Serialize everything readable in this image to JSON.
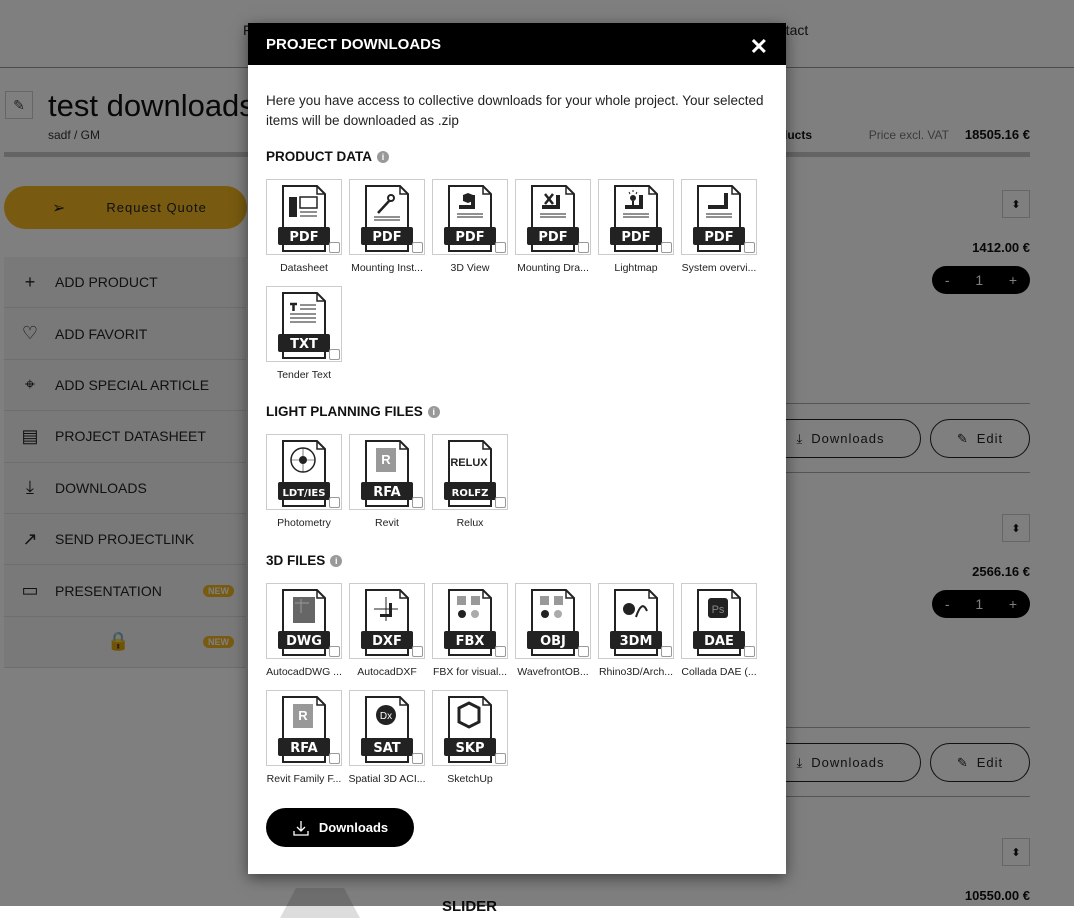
{
  "page": {
    "nav_left": "F",
    "nav_contact": "Contact",
    "title": "test downloads",
    "subtitle": "sadf / GM",
    "request_quote": "Request Quote",
    "sidebar": [
      {
        "icon": "plus-icon",
        "glyph": "+",
        "label": "ADD PRODUCT"
      },
      {
        "icon": "heart-plus-icon",
        "glyph": "♡",
        "label": "ADD FAVORIT"
      },
      {
        "icon": "tag-icon",
        "glyph": "⌖",
        "label": "ADD SPECIAL ARTICLE"
      },
      {
        "icon": "document-icon",
        "glyph": "▤",
        "label": "PROJECT DATASHEET"
      },
      {
        "icon": "download-icon",
        "glyph": "⤓",
        "label": "DOWNLOADS"
      },
      {
        "icon": "external-link-icon",
        "glyph": "↗",
        "label": "SEND PROJECTLINK"
      },
      {
        "icon": "presentation-icon",
        "glyph": "▭",
        "label": "PRESENTATION",
        "badge": "NEW"
      },
      {
        "icon": "lock-icon",
        "glyph": "🔒",
        "label": "",
        "badge": "NEW"
      }
    ],
    "products_label": "Products",
    "price_label": "Price excl. VAT",
    "total": "18505.16 €",
    "items": [
      {
        "price": "1412.00 €",
        "qty": "1"
      },
      {
        "price": "2566.16 €",
        "qty": "1"
      },
      {
        "price": "10550.00 €",
        "name": "SLIDER"
      }
    ],
    "downloads_btn": "Downloads",
    "edit_btn": "Edit",
    "minus": "-",
    "plus": "+"
  },
  "modal": {
    "title": "PROJECT DOWNLOADS",
    "close": "✕",
    "intro": "Here you have access to collective downloads for your whole project. Your selected items will be downloaded as .zip",
    "download_button": "Downloads",
    "sections": [
      {
        "title": "PRODUCT DATA",
        "items": [
          {
            "label": "Datasheet",
            "type": "PDF",
            "glyph": "datasheet"
          },
          {
            "label": "Mounting Inst...",
            "type": "PDF",
            "glyph": "wrench"
          },
          {
            "label": "3D View",
            "type": "PDF",
            "glyph": "cube"
          },
          {
            "label": "Mounting Dra...",
            "type": "PDF",
            "glyph": "tools"
          },
          {
            "label": "Lightmap",
            "type": "PDF",
            "glyph": "bulb"
          },
          {
            "label": "System overvi...",
            "type": "PDF",
            "glyph": "corner"
          },
          {
            "label": "Tender Text",
            "type": "TXT",
            "glyph": "text"
          }
        ]
      },
      {
        "title": "LIGHT PLANNING FILES",
        "items": [
          {
            "label": "Photometry",
            "type": "LDT/IES",
            "glyph": "photometry"
          },
          {
            "label": "Revit",
            "type": "RFA",
            "glyph": "revit"
          },
          {
            "label": "Relux",
            "type": "ROLFZ",
            "glyph": "relux"
          }
        ]
      },
      {
        "title": "3D FILES",
        "items": [
          {
            "label": "AutocadDWG ...",
            "type": "DWG",
            "glyph": "dwg"
          },
          {
            "label": "AutocadDXF",
            "type": "DXF",
            "glyph": "crosshair"
          },
          {
            "label": "FBX for visual...",
            "type": "FBX",
            "glyph": "apps"
          },
          {
            "label": "WavefrontOB...",
            "type": "OBJ",
            "glyph": "apps"
          },
          {
            "label": "Rhino3D/Arch...",
            "type": "3DM",
            "glyph": "rhino"
          },
          {
            "label": "Collada DAE (...",
            "type": "DAE",
            "glyph": "ps"
          },
          {
            "label": "Revit Family F...",
            "type": "RFA",
            "glyph": "revit"
          },
          {
            "label": "Spatial 3D ACI...",
            "type": "SAT",
            "glyph": "dx"
          },
          {
            "label": "SketchUp",
            "type": "SKP",
            "glyph": "sketchup"
          }
        ]
      }
    ]
  }
}
